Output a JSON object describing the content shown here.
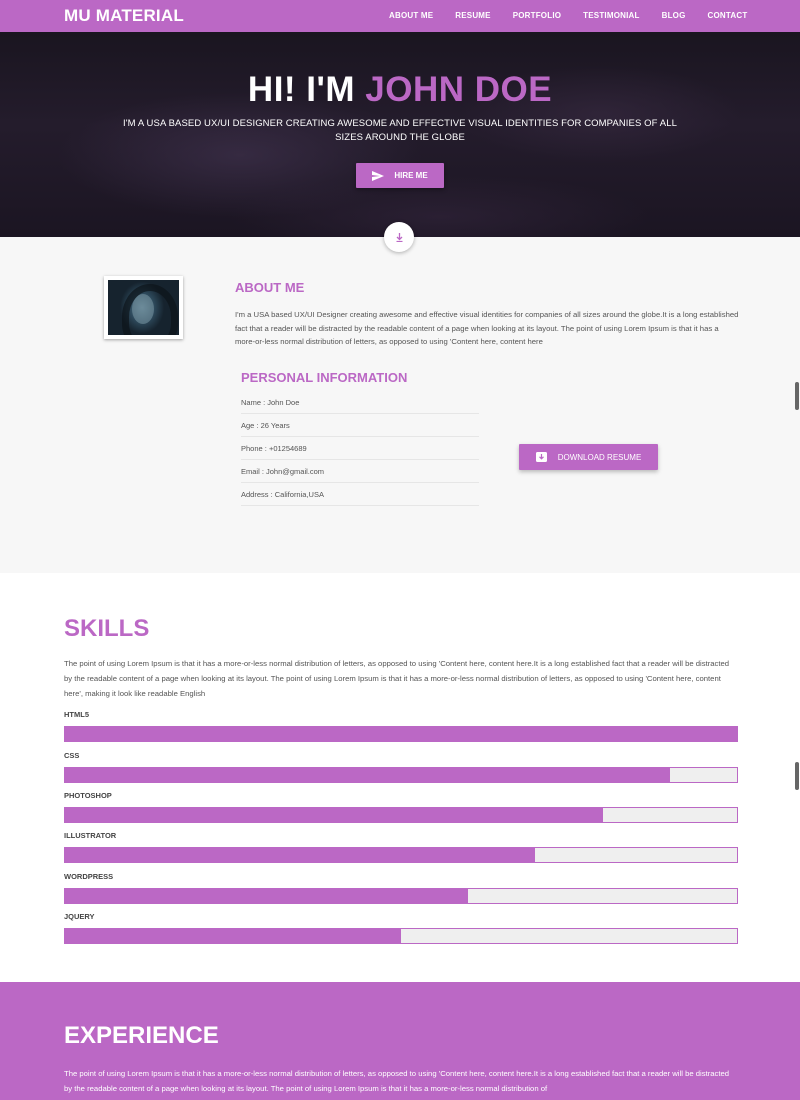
{
  "nav": {
    "brand": "MU MATERIAL",
    "items": [
      "ABOUT ME",
      "RESUME",
      "PORTFOLIO",
      "TESTIMONIAL",
      "BLOG",
      "CONTACT"
    ]
  },
  "hero": {
    "greeting": "HI! I'M",
    "name": "JOHN DOE",
    "subtitle": "I'M A USA BASED UX/UI DESIGNER CREATING AWESOME AND EFFECTIVE VISUAL IDENTITIES FOR COMPANIES OF ALL SIZES AROUND THE GLOBE",
    "hire_label": "HIRE ME"
  },
  "about": {
    "title": "ABOUT ME",
    "text": "I'm a USA based UX/UI Designer creating awesome and effective visual identities for companies of all sizes around the globe.It is a long established fact that a reader will be distracted by the readable content of a page when looking at its layout. The point of using Lorem Ipsum is that it has a more-or-less normal distribution of letters, as opposed to using 'Content here, content here",
    "personal_title": "PERSONAL INFORMATION",
    "personal": [
      "Name : John Doe",
      "Age : 26 Years",
      "Phone : +01254689",
      "Email : John@gmail.com",
      "Address : California,USA"
    ],
    "download_label": "DOWNLOAD RESUME"
  },
  "skills": {
    "title": "SKILLS",
    "text": "The point of using Lorem Ipsum is that it has a more-or-less normal distribution of letters, as opposed to using 'Content here, content here.It is a long established fact that a reader will be distracted by the readable content of a page when looking at its layout. The point of using Lorem Ipsum is that it has a more-or-less normal distribution of letters, as opposed to using 'Content here, content here', making it look like readable English",
    "items": [
      {
        "name": "HTML5",
        "level": 1.0
      },
      {
        "name": "CSS",
        "level": 0.9
      },
      {
        "name": "PHOTOSHOP",
        "level": 0.8
      },
      {
        "name": "ILLUSTRATOR",
        "level": 0.7
      },
      {
        "name": "WORDPRESS",
        "level": 0.6
      },
      {
        "name": "JQUERY",
        "level": 0.5
      }
    ]
  },
  "experience": {
    "title": "EXPERIENCE",
    "text": "The point of using Lorem Ipsum is that it has a more-or-less normal distribution of letters, as opposed to using 'Content here, content here.It is a long established fact that a reader will be distracted by the readable content of a page when looking at its layout. The point of using Lorem Ipsum is that it has a more-or-less normal distribution of"
  },
  "colors": {
    "accent": "#bb68c5",
    "hero_bg": "#1f1826",
    "section_bg": "#f7f7f7"
  },
  "icons": {
    "hire": "send-icon",
    "scroll": "arrow-down-icon",
    "download": "download-icon"
  }
}
